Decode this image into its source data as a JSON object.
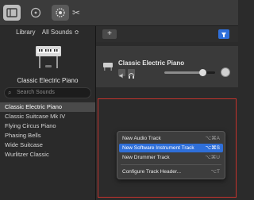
{
  "toolbar": {
    "library_icon": "library-icon",
    "help_icon": "help-icon",
    "smart_controls_icon": "smart-controls-icon",
    "scissors_icon": "scissors-icon",
    "scissors_glyph": "✂"
  },
  "library": {
    "title": "Library",
    "dropdown": "All Sounds ≎",
    "instrument_name": "Classic Electric Piano",
    "search_placeholder": "Search Sounds",
    "items": [
      {
        "label": "Classic Electric Piano",
        "selected": true
      },
      {
        "label": "Classic Suitcase Mk IV"
      },
      {
        "label": "Flying Circus Piano"
      },
      {
        "label": "Phasing Bells"
      },
      {
        "label": "Wide Suitcase"
      },
      {
        "label": "Wurlitzer Classic"
      }
    ]
  },
  "tracks": {
    "add_label": "+",
    "track": {
      "name": "Classic Electric Piano",
      "volume": 0.8
    }
  },
  "menu": {
    "items": [
      {
        "label": "New Audio Track",
        "shortcut": "⌥⌘A"
      },
      {
        "label": "New Software Instrument Track",
        "shortcut": "⌥⌘S",
        "highlighted": true
      },
      {
        "label": "New Drummer Track",
        "shortcut": "⌥⌘U"
      },
      {
        "label": "Configure Track Header...",
        "shortcut": "⌥T"
      }
    ]
  },
  "colors": {
    "accent": "#2f6fd9",
    "highlight_border": "#c4332d"
  }
}
